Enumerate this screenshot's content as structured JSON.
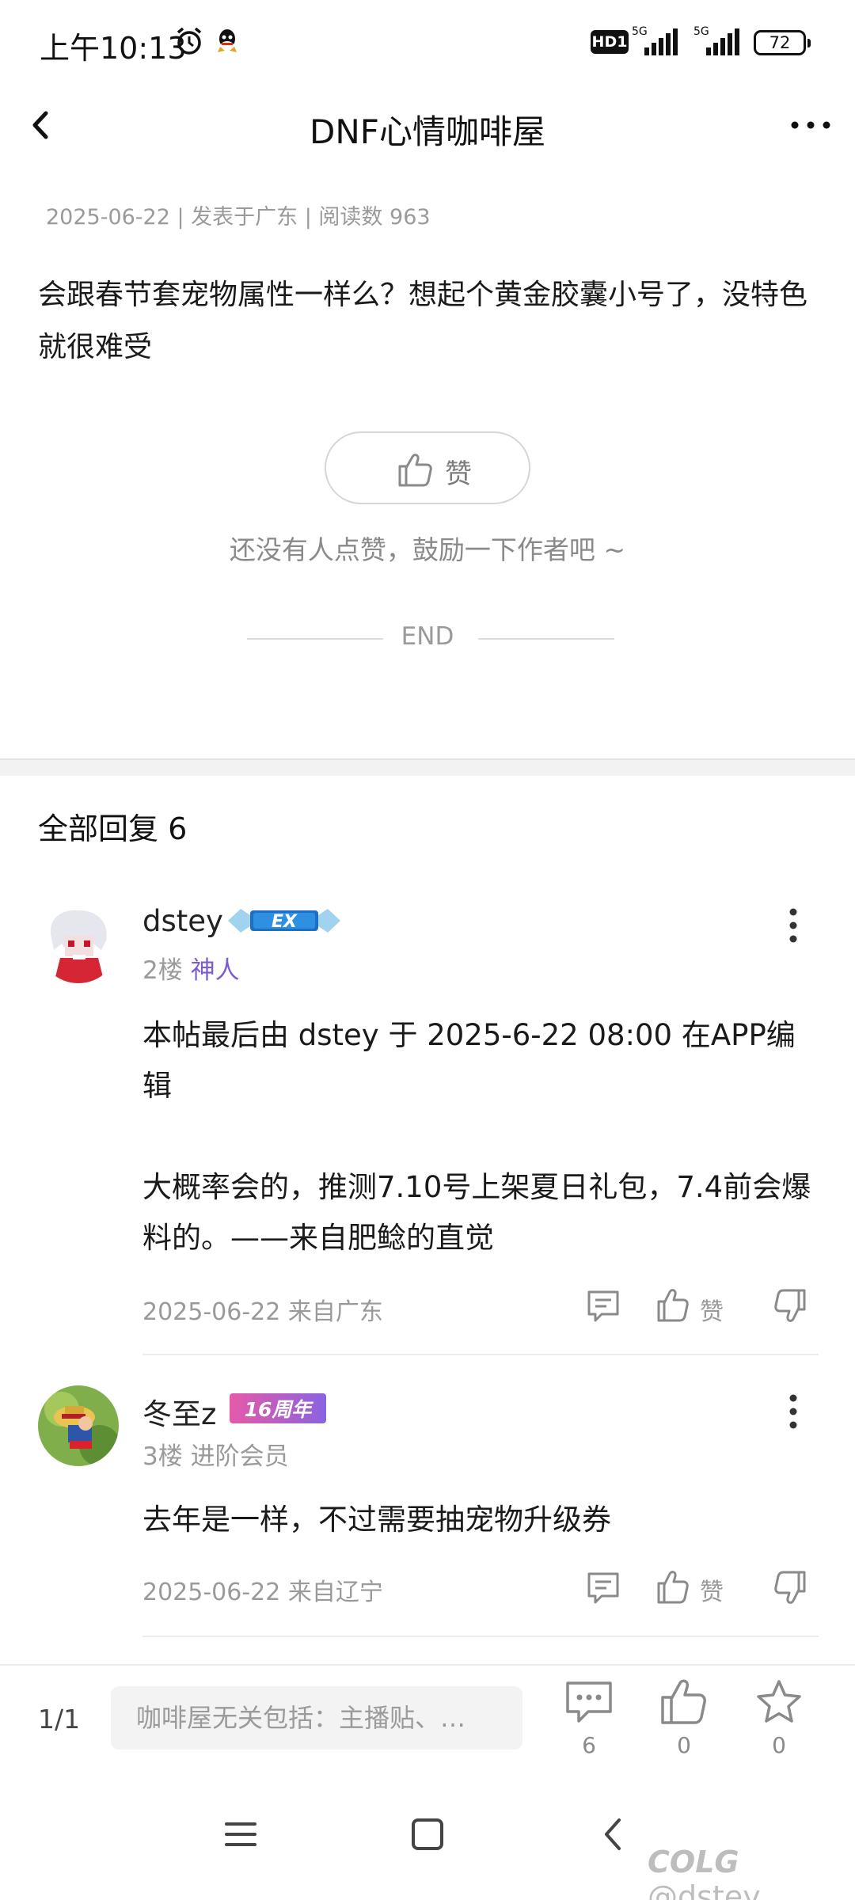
{
  "status_bar": {
    "time": "上午10:13",
    "hd_label": "HD1",
    "net1": "5G",
    "net2": "5G",
    "battery": "72"
  },
  "nav": {
    "title": "DNF心情咖啡屋"
  },
  "post": {
    "meta": "2025-06-22 | 发表于广东 | 阅读数 963",
    "body": "会跟春节套宠物属性一样么？想起个黄金胶囊小号了，没特色就很难受",
    "like_label": "赞",
    "like_hint": "还没有人点赞，鼓励一下作者吧 ~",
    "end_text": "END"
  },
  "replies": {
    "header": "全部回复  6",
    "items": [
      {
        "username": "dstey",
        "badge": "EX",
        "floor": "2楼",
        "rank": "神人",
        "text_line1": "本帖最后由 dstey 于 2025-6-22 08:00 在APP编辑",
        "text_line2": "大概率会的，推测7.10号上架夏日礼包，7.4前会爆料的。——来自肥鲶的直觉",
        "footer": "2025-06-22 来自广东",
        "like_label": "赞"
      },
      {
        "username": "冬至z",
        "badge": "16周年",
        "floor": "3楼",
        "rank": "进阶会员",
        "text": "去年是一样，不过需要抽宠物升级券",
        "footer": "2025-06-22 来自辽宁",
        "like_label": "赞"
      }
    ]
  },
  "bottom_bar": {
    "page": "1/1",
    "input_placeholder": "咖啡屋无关包括：主播贴、…",
    "comment_count": "6",
    "like_count": "0",
    "fav_count": "0"
  },
  "watermark": {
    "site": "COLG",
    "user": "@dstey"
  },
  "colors": {
    "rank_purple": "#7d5bd0",
    "badge_blue": "#2f7fd6",
    "badge_pink": "#e65aa8"
  }
}
